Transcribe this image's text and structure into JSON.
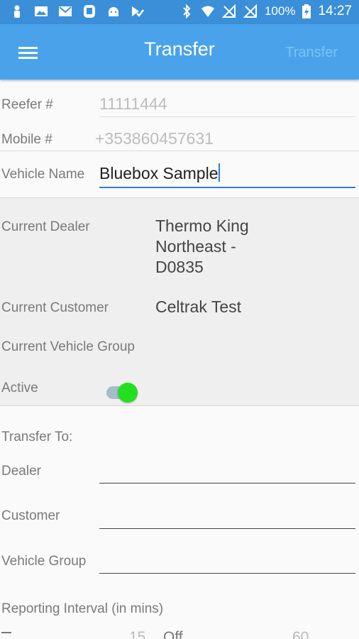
{
  "status_bar": {
    "battery": "100%",
    "time": "14:27",
    "icons_left": [
      "person-icon",
      "image-icon",
      "mail-icon",
      "shield-icon",
      "android-icon",
      "check-icon"
    ],
    "icons_right": [
      "bluetooth-icon",
      "wifi-icon",
      "signal-icon",
      "signal-icon",
      "battery-icon"
    ]
  },
  "app_bar": {
    "title": "Transfer",
    "action_label": "Transfer",
    "action_color": "#7cc3f5",
    "background": "#4aa3ea"
  },
  "unit": {
    "reefer_label": "Reefer #",
    "reefer_value": "11111444",
    "mobile_label": "Mobile #",
    "mobile_value": "+353860457631",
    "vehicle_name_label": "Vehicle Name",
    "vehicle_name_value": "Bluebox Sample"
  },
  "current": {
    "dealer_label": "Current Dealer",
    "dealer_line1": "Thermo King",
    "dealer_line2": "Northeast -",
    "dealer_line3": "D0835",
    "customer_label": "Current Customer",
    "customer_value": "Celtrak Test",
    "vehicle_group_label": "Current Vehicle Group",
    "active_label": "Active",
    "active_on": true
  },
  "transfer": {
    "heading": "Transfer To:",
    "dealer_label": "Dealer",
    "customer_label": "Customer",
    "vehicle_group_label": "Vehicle Group",
    "reporting_label": "Reporting Interval (in mins)",
    "interval_row_left_value": "15",
    "interval_row_mid_label": "Off",
    "interval_row_right_value": "60"
  }
}
